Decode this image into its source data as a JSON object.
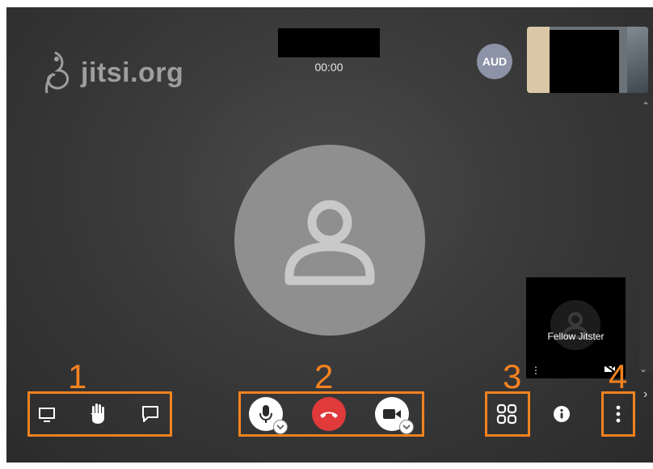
{
  "logo": {
    "text": "jitsi.org"
  },
  "call": {
    "timer": "00:00"
  },
  "participants": {
    "audio_only_initials": "AUD",
    "fellow_tile_name": "Fellow Jitster"
  },
  "annotations": {
    "labels": [
      "1",
      "2",
      "3",
      "4"
    ],
    "accent_color": "#f5821f"
  },
  "toolbar": {
    "left_group": [
      "screen-share-icon",
      "raise-hand-icon",
      "chat-icon"
    ],
    "center_group": [
      "microphone-icon",
      "hangup-icon",
      "camera-icon"
    ],
    "right_group": [
      "tile-view-icon",
      "info-icon",
      "more-options-icon"
    ],
    "hangup_color": "#e03a3a"
  }
}
